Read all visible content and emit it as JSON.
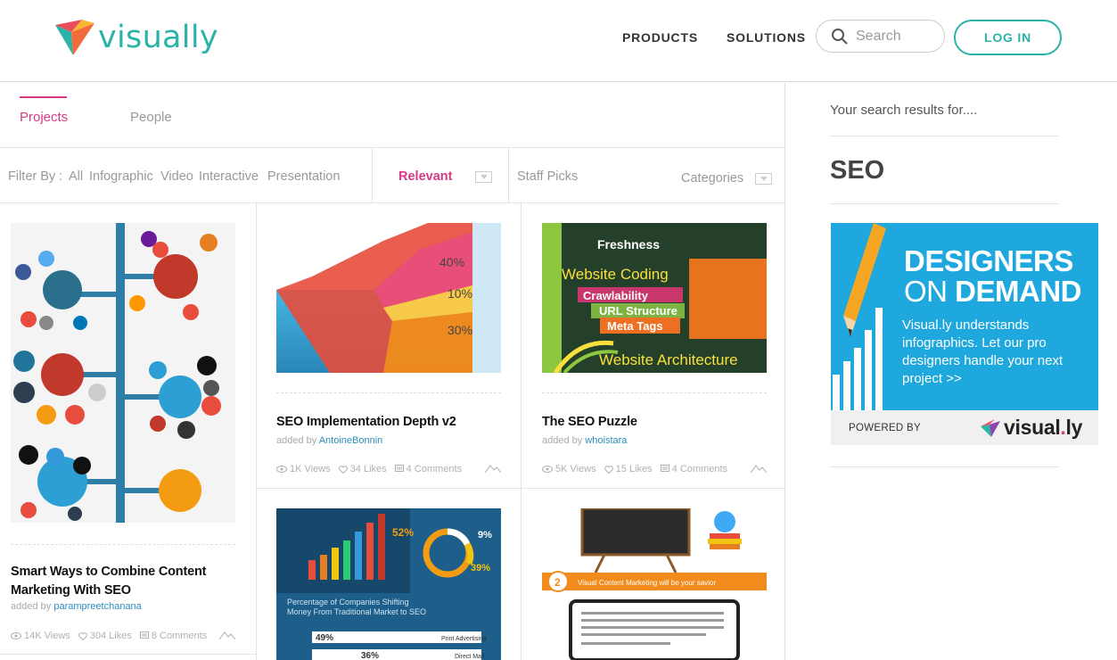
{
  "header": {
    "logo_text": "visually",
    "nav": [
      "PRODUCTS",
      "SOLUTIONS"
    ],
    "search_placeholder": "Search",
    "login_label": "LOG IN"
  },
  "tabs": [
    "Projects",
    "People"
  ],
  "filters": {
    "label": "Filter By :",
    "options": [
      "All",
      "Infographic",
      "Video",
      "Interactive",
      "Presentation"
    ],
    "sort": "Relevant",
    "staff_picks": "Staff Picks",
    "categories": "Categories"
  },
  "cards": [
    {
      "title": "Smart Ways to Combine Content Marketing With SEO",
      "added_by": "added by",
      "author": "parampreetchanana",
      "views": "14K Views",
      "likes": "304 Likes",
      "comments": "8 Comments"
    },
    {
      "title": "SEO Implementation Depth v2",
      "added_by": "added by",
      "author": "AntoineBonnin",
      "views": "1K Views",
      "likes": "34 Likes",
      "comments": "4 Comments"
    },
    {
      "title": "The SEO Puzzle",
      "added_by": "added by",
      "author": "whoistara",
      "views": "5K Views",
      "likes": "15 Likes",
      "comments": "4 Comments"
    }
  ],
  "thumb_text": {
    "seo_depth": [
      "40%",
      "10%",
      "30%"
    ],
    "puzzle": [
      "Freshness",
      "Website Coding",
      "Crawlability",
      "URL Structure",
      "Meta Tags",
      "Website Architecture"
    ],
    "shifting": [
      "52%",
      "9%",
      "39%",
      "Percentage of Companies Shifting",
      "Money From Traditional Market to SEO",
      "49%",
      "36%",
      "Print Advertising",
      "Direct Mail"
    ],
    "content_mkt": [
      "Visual Content Marketing will be your savior",
      "2"
    ]
  },
  "sidebar": {
    "heading": "Your search results for....",
    "term": "SEO"
  },
  "ad": {
    "line1": "DESIGNERS",
    "line2_a": "ON ",
    "line2_b": "DEMAND",
    "body": "Visual.ly understands infographics. Let our pro designers handle your next project  >>",
    "powered_by": "POWERED BY",
    "brand_a": "visual",
    "brand_dot": ".",
    "brand_b": "ly"
  },
  "colors": {
    "accent": "#d63a84",
    "teal": "#2bb3a8",
    "link": "#2a8fbd",
    "ad_blue": "#1fa8de"
  }
}
